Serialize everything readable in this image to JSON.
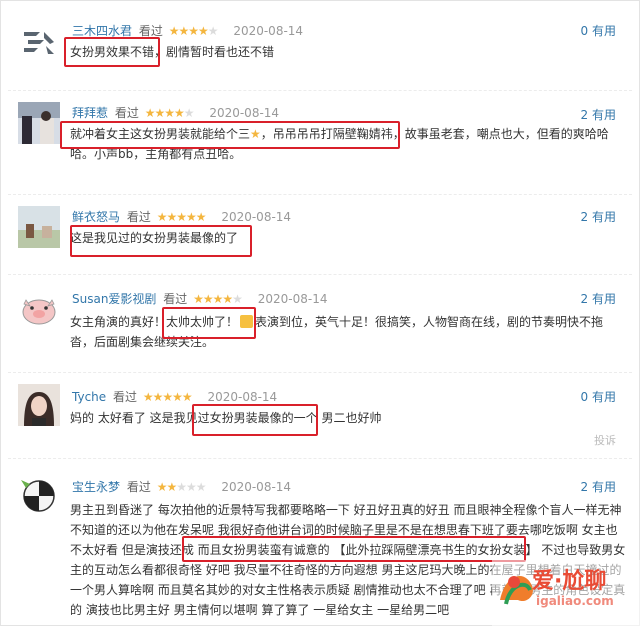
{
  "reviews": [
    {
      "user": "三木四水君",
      "status": "看过",
      "stars": 4,
      "date": "2020-08-14",
      "useful": "0 有用",
      "content": "女扮男效果不错，剧情暂时看也还不错"
    },
    {
      "user": "拜拜惹",
      "status": "看过",
      "stars": 4,
      "date": "2020-08-14",
      "useful": "2 有用",
      "content_a": "就冲着女主这女扮男装就能给个三",
      "content_b": "，吊吊吊吊打隔壁鞠婧祎，故事虽老套，嘲点也大，但看的爽哈哈哈。小声bb，主角都有点丑哈。"
    },
    {
      "user": "鲜衣怒马",
      "status": "看过",
      "stars": 5,
      "date": "2020-08-14",
      "useful": "2 有用",
      "content": "这是我见过的女扮男装最像的了"
    },
    {
      "user": "Susan爱影视剧",
      "status": "看过",
      "stars": 4,
      "date": "2020-08-14",
      "useful": "2 有用",
      "content_a": "女主角演的真好！太帅太帅了！",
      "content_b": "表演到位，英气十足！很搞笑，人物智商在线，剧的节奏明快不拖沓，后面剧集会继续关注。"
    },
    {
      "user": "Tyche",
      "status": "看过",
      "stars": 5,
      "date": "2020-08-14",
      "useful": "0 有用",
      "content": "妈的 太好看了 这是我见过女扮男装最像的一个 男二也好帅",
      "report": "投诉"
    },
    {
      "user": "宝生永梦",
      "status": "看过",
      "stars": 2,
      "date": "2020-08-14",
      "useful": "2 有用",
      "content": "男主丑到昏迷了 每次拍他的近景特写我都要略略一下 好丑好丑真的好丑 而且眼神全程像个盲人一样无神不知道的还以为他在发呆呢 我很好奇他讲台词的时候脑子里是不是在想思春下班了要去哪吃饭啊 女主也不太好看 但是演技还成 而且女扮男装蛮有诚意的 【此外拉踩隔壁漂亮书生的女扮女装】 不过也导致男女主的互动怎么看都很奇怪 好吧 我尽量不往奇怪的方向遐想 男主这尼玛大晚上的在屋子里想着白天撞过的一个男人算啥啊 而且莫名其妙的对女主性格表示质疑 剧情推动也太不合理了吧 再就是 男主的角色设定真的 演技也比男主好 男主情何以堪啊 算了算了 一星给女主 一星给男二吧"
    }
  ],
  "watermark": {
    "text": "爱·尬聊",
    "url": "igaliao.com"
  },
  "colors": {
    "link": "#3377aa",
    "star": "#f4b63f",
    "highlight_box": "#d9202a"
  }
}
